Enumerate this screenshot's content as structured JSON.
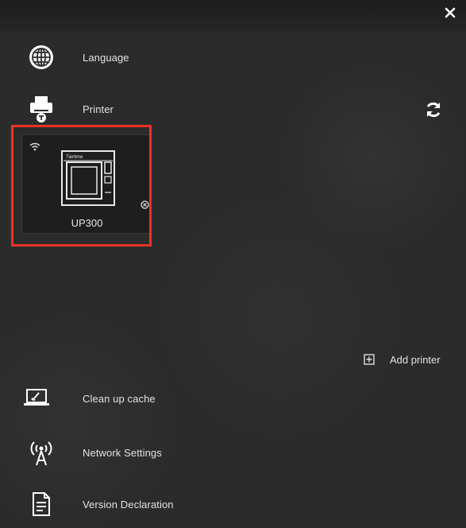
{
  "menu": {
    "language_label": "Language",
    "printer_label": "Printer",
    "clean_cache_label": "Clean up cache",
    "network_label": "Network Settings",
    "version_label": "Version Declaration"
  },
  "printer_card": {
    "name": "UP300",
    "brand_text": "Tiertime"
  },
  "add_printer_label": "Add printer",
  "colors": {
    "background": "#2b2b2b",
    "highlight": "#e83224",
    "text": "#e6e6e6"
  },
  "icons": {
    "close": "close-icon",
    "language": "globe-icon",
    "printer": "printer-icon",
    "refresh": "refresh-icon",
    "wifi": "wifi-icon",
    "remove": "remove-icon",
    "add": "plus-box-icon",
    "clean": "laptop-broom-icon",
    "network": "antenna-icon",
    "version": "document-icon"
  }
}
